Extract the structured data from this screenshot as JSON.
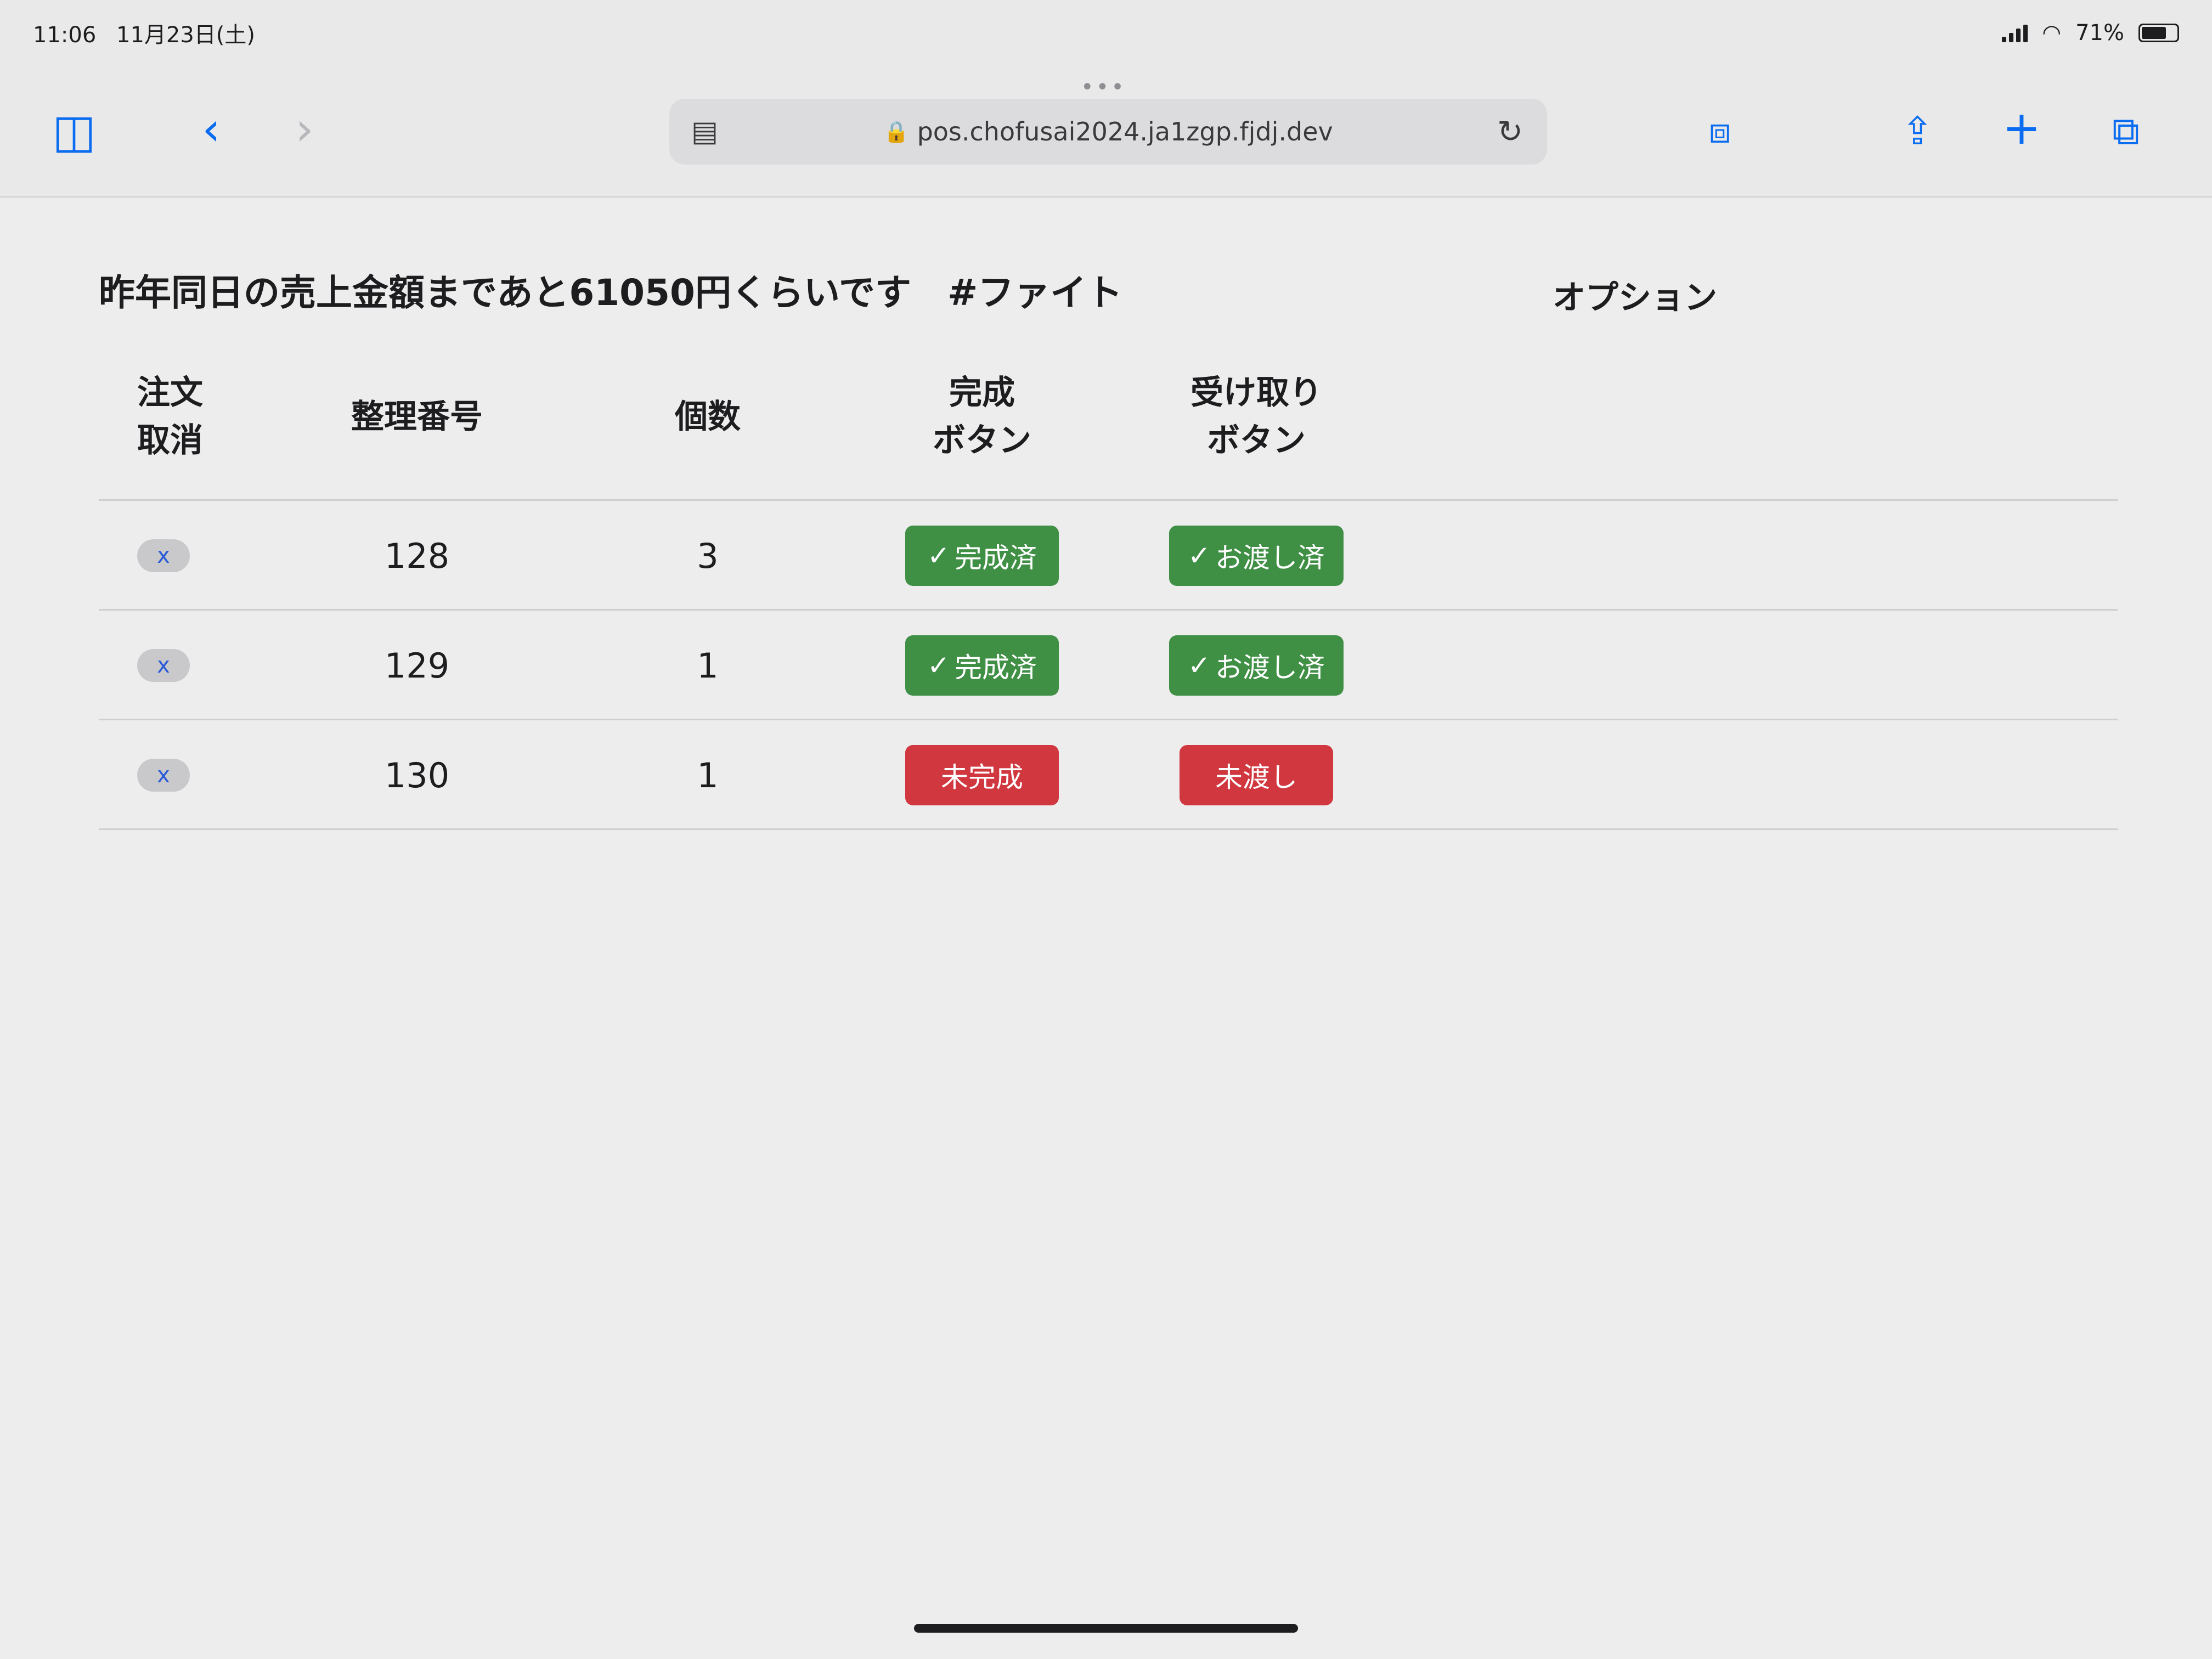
{
  "status_bar": {
    "time": "11:06",
    "date": "11月23日(土)",
    "battery": "71%"
  },
  "browser": {
    "url": "pos.chofusai2024.ja1zgp.fjdj.dev",
    "back_glyph": "‹",
    "forward_glyph": "›",
    "share_glyph": "⇪",
    "new_tab_glyph": "+",
    "tabs_glyph": "⧉",
    "sidebar_glyph": "◫",
    "reader_glyph": "▤",
    "reload_glyph": "↻",
    "lock_glyph": "🔒",
    "more_dots": "•••",
    "extension_glyph": "⧈"
  },
  "page": {
    "heading": "昨年同日の売上金額まであと61050円くらいです　#ファイト",
    "columns": {
      "cancel_line1": "注文",
      "cancel_line2": "取消",
      "number": "整理番号",
      "quantity": "個数",
      "done_line1": "完成",
      "done_line2": "ボタン",
      "received_line1": "受け取り",
      "received_line2": "ボタン",
      "option": "オプション"
    },
    "rows": [
      {
        "cancel": "x",
        "number": "128",
        "quantity": "3",
        "done_status": "完成済",
        "done_state": "complete",
        "received_status": "お渡し済",
        "received_state": "complete"
      },
      {
        "cancel": "x",
        "number": "129",
        "quantity": "1",
        "done_status": "完成済",
        "done_state": "complete",
        "received_status": "お渡し済",
        "received_state": "complete"
      },
      {
        "cancel": "x",
        "number": "130",
        "quantity": "1",
        "done_status": "未完成",
        "done_state": "incomplete",
        "received_status": "未渡し",
        "received_state": "incomplete"
      }
    ],
    "check_glyph": "✓"
  },
  "colors": {
    "complete": "#3f8f45",
    "incomplete": "#d0373f",
    "accent": "#0a6cf0"
  }
}
